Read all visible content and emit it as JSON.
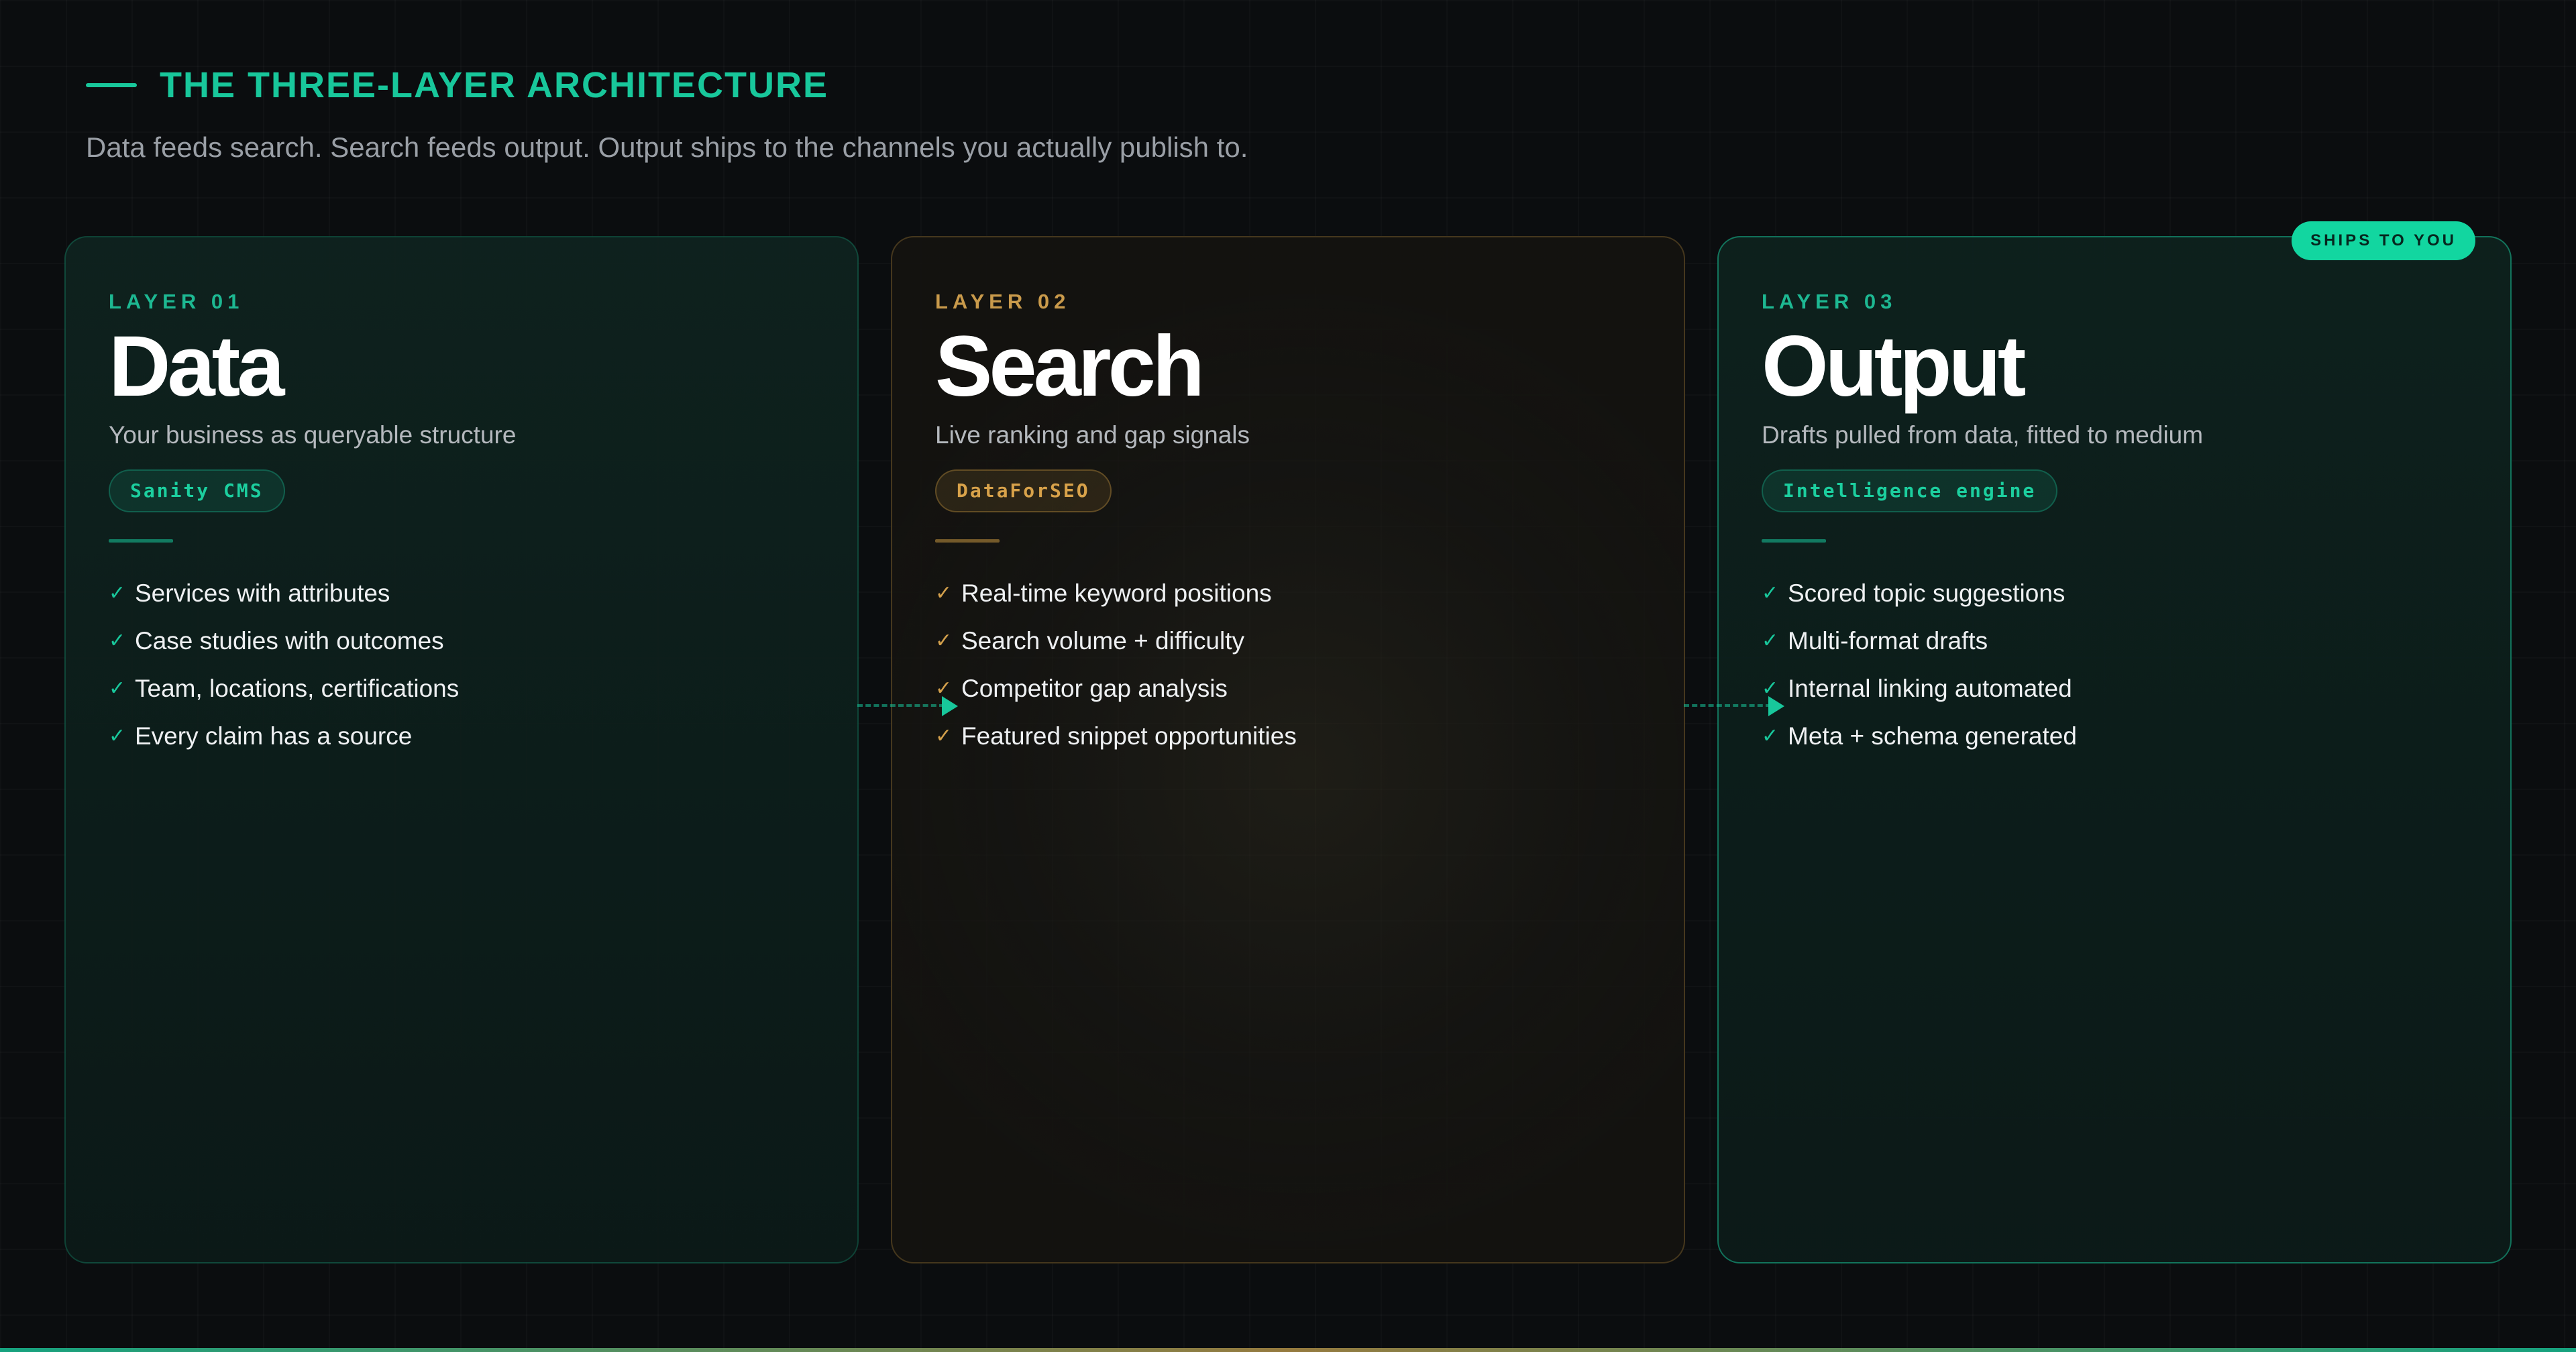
{
  "header": {
    "eyebrow": "THE THREE-LAYER ARCHITECTURE",
    "subtitle": "Data feeds search. Search feeds output. Output ships to the channels you actually publish to."
  },
  "cards": [
    {
      "layer": "LAYER 01",
      "title": "Data",
      "description": "Your business as queryable structure",
      "tool": "Sanity CMS",
      "features": [
        "Services with attributes",
        "Case studies with outcomes",
        "Team, locations, certifications",
        "Every claim has a source"
      ]
    },
    {
      "layer": "LAYER 02",
      "title": "Search",
      "description": "Live ranking and gap signals",
      "tool": "DataForSEO",
      "features": [
        "Real-time keyword positions",
        "Search volume + difficulty",
        "Competitor gap analysis",
        "Featured snippet opportunities"
      ]
    },
    {
      "layer": "LAYER 03",
      "title": "Output",
      "description": "Drafts pulled from data, fitted to medium",
      "tool": "Intelligence engine",
      "badge": "SHIPS TO YOU",
      "features": [
        "Scored topic suggestions",
        "Multi-format drafts",
        "Internal linking automated",
        "Meta + schema generated"
      ]
    }
  ],
  "icons": {
    "check": "✓",
    "connector": "arrow-right-icon"
  },
  "colors": {
    "accent_green": "#18c79b",
    "accent_gold": "#d3a04c",
    "background": "#0b0d0f"
  }
}
